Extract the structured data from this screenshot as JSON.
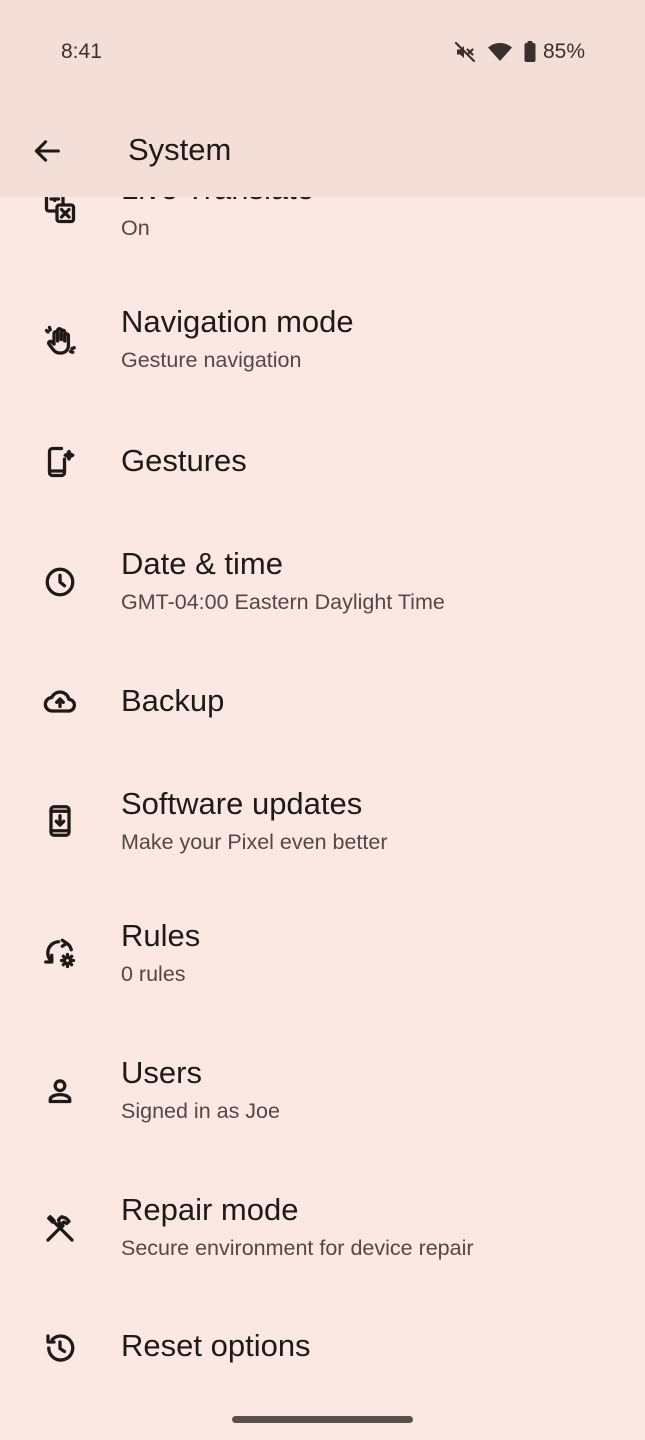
{
  "status_bar": {
    "time": "8:41",
    "battery": "85%",
    "icons": [
      "mute-vibrate-off-icon",
      "wifi-icon",
      "battery-icon"
    ]
  },
  "app_bar": {
    "title": "System",
    "back_icon": "arrow-left-icon"
  },
  "items": [
    {
      "title": "Live Translate",
      "subtitle": "On",
      "icon": "translate-icon"
    },
    {
      "title": "Navigation mode",
      "subtitle": "Gesture navigation",
      "icon": "hand-gesture-icon"
    },
    {
      "title": "Gestures",
      "subtitle": "",
      "icon": "phone-sparkle-icon"
    },
    {
      "title": "Date & time",
      "subtitle": "GMT-04:00 Eastern Daylight Time",
      "icon": "clock-icon"
    },
    {
      "title": "Backup",
      "subtitle": "",
      "icon": "cloud-upload-icon"
    },
    {
      "title": "Software updates",
      "subtitle": "Make your Pixel even better",
      "icon": "system-update-icon"
    },
    {
      "title": "Rules",
      "subtitle": "0 rules",
      "icon": "rules-sync-gear-icon"
    },
    {
      "title": "Users",
      "subtitle": "Signed in as Joe",
      "icon": "person-icon"
    },
    {
      "title": "Repair mode",
      "subtitle": "Secure environment for device repair",
      "icon": "tools-icon"
    },
    {
      "title": "Reset options",
      "subtitle": "",
      "icon": "history-icon"
    }
  ],
  "colors": {
    "background": "#fce8e2",
    "app_bar": "#f4dfd8",
    "text_primary": "#1f1a18",
    "text_secondary": "#544743"
  }
}
